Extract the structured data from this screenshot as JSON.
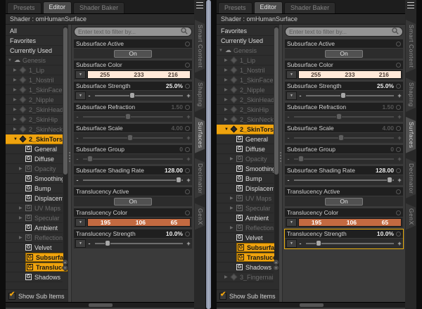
{
  "ui": {
    "slider_minus": "-",
    "slider_plus": "+",
    "dropdown_arrow": "▼",
    "expand_down": "▼",
    "expand_right": "▶",
    "group_letter": "G",
    "figure_glyph": "☁",
    "check_mark": "✔",
    "scroll_up": "▲",
    "scroll_down": "▼"
  },
  "colors": {
    "selection_yellow": "#efa30e",
    "pane_splitter_blue": "#99a1b5",
    "subsurface_swatch": "#ffe9d8",
    "translucency_swatch": "#c36a41"
  },
  "panels": [
    {
      "tabs": [
        {
          "label": "Presets",
          "active": false
        },
        {
          "label": "Editor",
          "active": true
        },
        {
          "label": "Shader Baker",
          "active": false
        }
      ],
      "shader_label": "Shader : omHumanSurface",
      "filter_placeholder": "Enter text to filter by...",
      "tree": {
        "items": [
          {
            "label": "All",
            "kind": "root",
            "dim": false,
            "arrow": "",
            "selected": false,
            "highlight": false
          },
          {
            "label": "Favorites",
            "kind": "root",
            "dim": false,
            "arrow": "",
            "selected": false,
            "highlight": false
          },
          {
            "label": "Currently Used",
            "kind": "root",
            "dim": false,
            "arrow": "",
            "selected": false,
            "highlight": false
          },
          {
            "label": "Genesis",
            "kind": "figure",
            "dim": true,
            "arrow": "down",
            "selected": false,
            "highlight": false
          },
          {
            "label": "1_Lip",
            "kind": "node",
            "dim": true,
            "arrow": "right",
            "selected": false,
            "highlight": false
          },
          {
            "label": "1_Nostril",
            "kind": "node",
            "dim": true,
            "arrow": "right",
            "selected": false,
            "highlight": false
          },
          {
            "label": "1_SkinFace",
            "kind": "node",
            "dim": true,
            "arrow": "right",
            "selected": false,
            "highlight": false
          },
          {
            "label": "2_Nipple",
            "kind": "node",
            "dim": true,
            "arrow": "right",
            "selected": false,
            "highlight": false
          },
          {
            "label": "2_SkinHead",
            "kind": "node",
            "dim": true,
            "arrow": "right",
            "selected": false,
            "highlight": false
          },
          {
            "label": "2_SkinHip",
            "kind": "node",
            "dim": true,
            "arrow": "right",
            "selected": false,
            "highlight": false
          },
          {
            "label": "2_SkinNeck",
            "kind": "node",
            "dim": true,
            "arrow": "right",
            "selected": false,
            "highlight": false
          },
          {
            "label": "2_SkinTorso",
            "kind": "node",
            "dim": false,
            "arrow": "down",
            "selected": true,
            "highlight": false
          },
          {
            "label": "General",
            "kind": "group",
            "dim": false,
            "arrow": "",
            "selected": false,
            "highlight": false
          },
          {
            "label": "Diffuse",
            "kind": "group",
            "dim": false,
            "arrow": "",
            "selected": false,
            "highlight": false
          },
          {
            "label": "Opacity",
            "kind": "group",
            "dim": true,
            "arrow": "right",
            "selected": false,
            "highlight": false
          },
          {
            "label": "Smoothing",
            "kind": "group",
            "dim": false,
            "arrow": "",
            "selected": false,
            "highlight": false
          },
          {
            "label": "Bump",
            "kind": "group",
            "dim": false,
            "arrow": "",
            "selected": false,
            "highlight": false
          },
          {
            "label": "Displacem...",
            "kind": "group",
            "dim": false,
            "arrow": "",
            "selected": false,
            "highlight": false
          },
          {
            "label": "UV Maps",
            "kind": "group",
            "dim": true,
            "arrow": "right",
            "selected": false,
            "highlight": false
          },
          {
            "label": "Specular",
            "kind": "group",
            "dim": true,
            "arrow": "right",
            "selected": false,
            "highlight": false
          },
          {
            "label": "Ambient",
            "kind": "group",
            "dim": false,
            "arrow": "",
            "selected": false,
            "highlight": false
          },
          {
            "label": "Reflection",
            "kind": "group",
            "dim": true,
            "arrow": "right",
            "selected": false,
            "highlight": false
          },
          {
            "label": "Velvet",
            "kind": "group",
            "dim": false,
            "arrow": "",
            "selected": false,
            "highlight": false
          },
          {
            "label": "Subsurfac...",
            "kind": "group",
            "dim": false,
            "arrow": "",
            "selected": false,
            "highlight": true
          },
          {
            "label": "Transluce...",
            "kind": "group",
            "dim": false,
            "arrow": "",
            "selected": false,
            "highlight": true
          },
          {
            "label": "Shadows",
            "kind": "group",
            "dim": false,
            "arrow": "",
            "selected": false,
            "highlight": false
          }
        ],
        "footer_label": "Show Sub Items",
        "footer_checked": true
      },
      "sections": [
        {
          "kind": "toggle",
          "label": "Subsurface Active",
          "button_label": "On"
        },
        {
          "kind": "color",
          "label": "Subsurface Color",
          "r": 255,
          "g": 233,
          "b": 216
        },
        {
          "kind": "slider",
          "label": "Subsurface Strength",
          "value": "25.0%",
          "dim": false,
          "dropdown": true,
          "thumb_pct": 42,
          "highlighted": false
        },
        {
          "kind": "slider",
          "label": "Subsurface Refraction",
          "value": "1.50",
          "dim": true,
          "dropdown": false,
          "thumb_pct": 45,
          "highlighted": false
        },
        {
          "kind": "slider",
          "label": "Subsurface Scale",
          "value": "4.00",
          "dim": true,
          "dropdown": false,
          "thumb_pct": 47,
          "highlighted": false
        },
        {
          "kind": "slider",
          "label": "Subsurface Group",
          "value": "0",
          "dim": true,
          "dropdown": false,
          "thumb_pct": 7,
          "highlighted": false
        },
        {
          "kind": "slider",
          "label": "Subsurface Shading Rate",
          "value": "128.00",
          "dim": false,
          "dropdown": false,
          "thumb_pct": 96,
          "highlighted": false
        },
        {
          "kind": "toggle",
          "label": "Translucency Active",
          "button_label": "On"
        },
        {
          "kind": "color",
          "label": "Translucency Color",
          "r": 195,
          "g": 106,
          "b": 65
        },
        {
          "kind": "slider",
          "label": "Translucency Strength",
          "value": "10.0%",
          "dim": false,
          "dropdown": true,
          "thumb_pct": 14,
          "highlighted": false
        }
      ],
      "side_tabs": [
        {
          "label": "Smart Content",
          "active": false
        },
        {
          "label": "Shaping",
          "active": false
        },
        {
          "label": "Surfaces",
          "active": true
        },
        {
          "label": "Decimator",
          "active": false
        },
        {
          "label": "GenX",
          "active": false
        }
      ]
    },
    {
      "tabs": [
        {
          "label": "Presets",
          "active": false
        },
        {
          "label": "Editor",
          "active": true
        },
        {
          "label": "Shader Baker",
          "active": false
        }
      ],
      "shader_label": "Shader : omHumanSurface",
      "filter_placeholder": "Enter text to filter by...",
      "tree": {
        "items": [
          {
            "label": "Favorites",
            "kind": "root",
            "dim": false,
            "arrow": "",
            "selected": false,
            "highlight": false
          },
          {
            "label": "Currently Used",
            "kind": "root",
            "dim": false,
            "arrow": "",
            "selected": false,
            "highlight": false
          },
          {
            "label": "Genesis",
            "kind": "figure",
            "dim": true,
            "arrow": "down",
            "selected": false,
            "highlight": false
          },
          {
            "label": "1_Lip",
            "kind": "node",
            "dim": true,
            "arrow": "right",
            "selected": false,
            "highlight": false
          },
          {
            "label": "1_Nostril",
            "kind": "node",
            "dim": true,
            "arrow": "right",
            "selected": false,
            "highlight": false
          },
          {
            "label": "1_SkinFace",
            "kind": "node",
            "dim": true,
            "arrow": "right",
            "selected": false,
            "highlight": false
          },
          {
            "label": "2_Nipple",
            "kind": "node",
            "dim": true,
            "arrow": "right",
            "selected": false,
            "highlight": false
          },
          {
            "label": "2_SkinHead",
            "kind": "node",
            "dim": true,
            "arrow": "right",
            "selected": false,
            "highlight": false
          },
          {
            "label": "2_SkinHip",
            "kind": "node",
            "dim": true,
            "arrow": "right",
            "selected": false,
            "highlight": false
          },
          {
            "label": "2_SkinNeck",
            "kind": "node",
            "dim": true,
            "arrow": "right",
            "selected": false,
            "highlight": false
          },
          {
            "label": "2_SkinTorso",
            "kind": "node",
            "dim": false,
            "arrow": "down",
            "selected": true,
            "highlight": false
          },
          {
            "label": "General",
            "kind": "group",
            "dim": false,
            "arrow": "",
            "selected": false,
            "highlight": false
          },
          {
            "label": "Diffuse",
            "kind": "group",
            "dim": false,
            "arrow": "",
            "selected": false,
            "highlight": false
          },
          {
            "label": "Opacity",
            "kind": "group",
            "dim": true,
            "arrow": "right",
            "selected": false,
            "highlight": false
          },
          {
            "label": "Smoothing",
            "kind": "group",
            "dim": false,
            "arrow": "",
            "selected": false,
            "highlight": false
          },
          {
            "label": "Bump",
            "kind": "group",
            "dim": false,
            "arrow": "",
            "selected": false,
            "highlight": false
          },
          {
            "label": "Displacem...",
            "kind": "group",
            "dim": false,
            "arrow": "",
            "selected": false,
            "highlight": false
          },
          {
            "label": "UV Maps",
            "kind": "group",
            "dim": true,
            "arrow": "right",
            "selected": false,
            "highlight": false
          },
          {
            "label": "Specular",
            "kind": "group",
            "dim": true,
            "arrow": "right",
            "selected": false,
            "highlight": false
          },
          {
            "label": "Ambient",
            "kind": "group",
            "dim": false,
            "arrow": "",
            "selected": false,
            "highlight": false
          },
          {
            "label": "Reflection",
            "kind": "group",
            "dim": true,
            "arrow": "right",
            "selected": false,
            "highlight": false
          },
          {
            "label": "Velvet",
            "kind": "group",
            "dim": false,
            "arrow": "",
            "selected": false,
            "highlight": false
          },
          {
            "label": "Subsurfac...",
            "kind": "group",
            "dim": false,
            "arrow": "",
            "selected": false,
            "highlight": true
          },
          {
            "label": "Transluce...",
            "kind": "group",
            "dim": false,
            "arrow": "",
            "selected": false,
            "highlight": true
          },
          {
            "label": "Shadows",
            "kind": "group",
            "dim": false,
            "arrow": "",
            "selected": false,
            "highlight": false
          },
          {
            "label": "3_Fingernail",
            "kind": "node",
            "dim": true,
            "arrow": "right",
            "selected": false,
            "highlight": false
          }
        ],
        "footer_label": "Show Sub Items",
        "footer_checked": true
      },
      "sections": [
        {
          "kind": "toggle",
          "label": "Subsurface Active",
          "button_label": "On"
        },
        {
          "kind": "color",
          "label": "Subsurface Color",
          "r": 255,
          "g": 233,
          "b": 216
        },
        {
          "kind": "slider",
          "label": "Subsurface Strength",
          "value": "25.0%",
          "dim": false,
          "dropdown": true,
          "thumb_pct": 42,
          "highlighted": false
        },
        {
          "kind": "slider",
          "label": "Subsurface Refraction",
          "value": "1.50",
          "dim": true,
          "dropdown": false,
          "thumb_pct": 45,
          "highlighted": false
        },
        {
          "kind": "slider",
          "label": "Subsurface Scale",
          "value": "4.00",
          "dim": true,
          "dropdown": false,
          "thumb_pct": 47,
          "highlighted": false
        },
        {
          "kind": "slider",
          "label": "Subsurface Group",
          "value": "0",
          "dim": true,
          "dropdown": false,
          "thumb_pct": 7,
          "highlighted": false
        },
        {
          "kind": "slider",
          "label": "Subsurface Shading Rate",
          "value": "128.00",
          "dim": false,
          "dropdown": false,
          "thumb_pct": 96,
          "highlighted": false
        },
        {
          "kind": "toggle",
          "label": "Translucency Active",
          "button_label": "On"
        },
        {
          "kind": "color",
          "label": "Translucency Color",
          "r": 195,
          "g": 106,
          "b": 65
        },
        {
          "kind": "slider",
          "label": "Translucency Strength",
          "value": "10.0%",
          "dim": false,
          "dropdown": true,
          "thumb_pct": 14,
          "highlighted": true
        }
      ],
      "side_tabs": [
        {
          "label": "Smart Content",
          "active": false
        },
        {
          "label": "Shaping",
          "active": false
        },
        {
          "label": "Surfaces",
          "active": true
        },
        {
          "label": "Decimator",
          "active": false
        },
        {
          "label": "GenX",
          "active": false
        }
      ]
    }
  ]
}
